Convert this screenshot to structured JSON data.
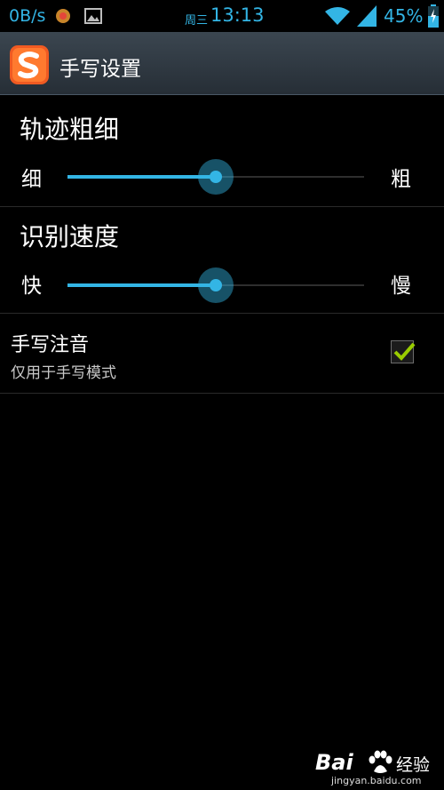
{
  "status_bar": {
    "net_speed": "0B/s",
    "weekday": "周三",
    "time": "13:13",
    "battery": "45%",
    "accent_color": "#33b5e5",
    "icons": [
      "notification-app-icon",
      "image-icon",
      "wifi-icon",
      "signal-icon",
      "battery-charging-icon"
    ]
  },
  "action_bar": {
    "title": "手写设置",
    "icon": "sogou-logo-icon"
  },
  "stroke_width": {
    "title": "轨迹粗细",
    "min_label": "细",
    "max_label": "粗",
    "value": 0.5
  },
  "recognition_speed": {
    "title": "识别速度",
    "min_label": "快",
    "max_label": "慢",
    "value": 0.5
  },
  "handwriting_pinyin": {
    "title": "手写注音",
    "summary": "仅用于手写模式",
    "checked": true
  },
  "watermark": {
    "text": "Bai",
    "text2": "经验",
    "url": "jingyan.baidu.com"
  }
}
